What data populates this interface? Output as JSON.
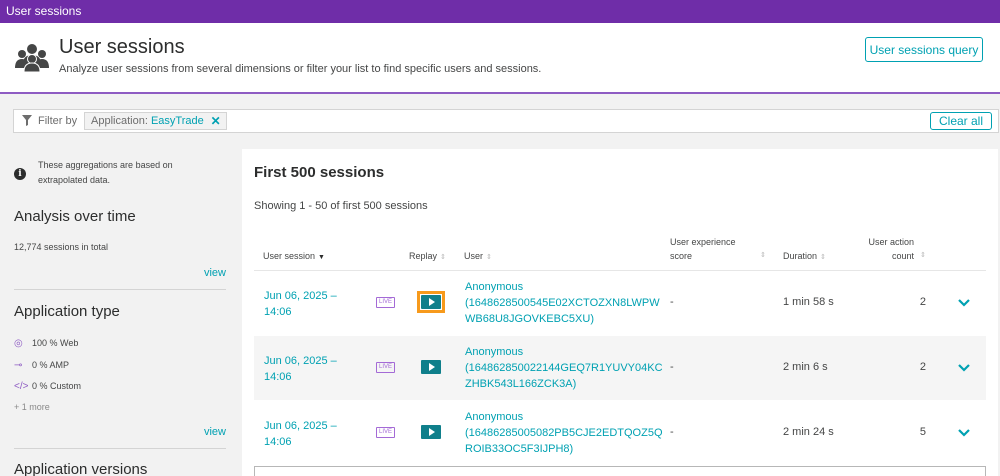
{
  "topbar": {
    "title": "User sessions"
  },
  "header": {
    "icon": "users-group-icon",
    "title": "User sessions",
    "subtitle": "Analyze user sessions from several dimensions or filter your list to find specific users and sessions.",
    "query_button": "User sessions query"
  },
  "filter": {
    "label": "Filter by",
    "chip_key": "Application: ",
    "chip_value": "EasyTrade",
    "clear_label": "Clear all"
  },
  "sidebar": {
    "info_text": "These aggregations are based on extrapolated data.",
    "analysis_title": "Analysis over time",
    "sessions_total": "12,774 sessions in total",
    "view_label": "view",
    "app_type_title": "Application type",
    "app_types": [
      {
        "icon": "globe-icon",
        "label": "100 % Web"
      },
      {
        "icon": "amp-icon",
        "label": "0 % AMP"
      },
      {
        "icon": "code-icon",
        "label": "0 % Custom"
      }
    ],
    "more_label": "+ 1 more",
    "app_versions_title": "Application versions"
  },
  "panel": {
    "title": "First 500 sessions",
    "subtitle": "Showing 1 - 50 of first 500 sessions",
    "columns": {
      "session": "User session",
      "replay": "Replay",
      "user": "User",
      "ux_line1": "User experience",
      "ux_line2": "score",
      "duration": "Duration",
      "count_line1": "User action",
      "count_line2": "count"
    },
    "rows": [
      {
        "date_line1": "Jun 06, 2025 –",
        "date_line2": "14:06",
        "live": "LIVE",
        "user_name": "Anonymous",
        "user_id_1": "(1648628500545E02XCTOZXN8LWPW",
        "user_id_2": "WB68U8JGOVKEBC5XU)",
        "ux": "-",
        "duration": "1 min 58 s",
        "count": "2"
      },
      {
        "date_line1": "Jun 06, 2025 –",
        "date_line2": "14:06",
        "live": "LIVE",
        "user_name": "Anonymous",
        "user_id_1": "(164862850022144GEQ7R1YUVY04KC",
        "user_id_2": "ZHBK543L166ZCK3A)",
        "ux": "-",
        "duration": "2 min 6 s",
        "count": "2"
      },
      {
        "date_line1": "Jun 06, 2025 –",
        "date_line2": "14:06",
        "live": "LIVE",
        "user_name": "Anonymous",
        "user_id_1": "(16486285005082PB5CJE2EDTQOZ5Q",
        "user_id_2": "ROIB33OC5F3IJPH8)",
        "ux": "-",
        "duration": "2 min 24 s",
        "count": "5"
      }
    ]
  },
  "colors": {
    "brand_purple": "#6f2da8",
    "accent_teal": "#00a1b2",
    "replay_button": "#0f7f8b",
    "focus_orange": "#f79a1c"
  }
}
